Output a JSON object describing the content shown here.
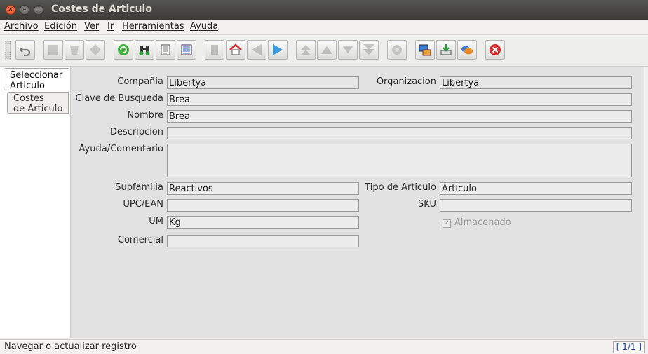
{
  "window": {
    "title": "Costes de Articulo"
  },
  "menu": [
    "Archivo",
    "Edición",
    "Ver",
    "Ir",
    "Herramientas",
    "Ayuda"
  ],
  "toolbar": [
    {
      "name": "undo-icon",
      "enabled": true
    },
    {
      "name": "new-record-icon",
      "enabled": false
    },
    {
      "name": "delete-record-icon",
      "enabled": false
    },
    {
      "name": "save-icon",
      "enabled": false
    },
    {
      "name": "refresh-icon",
      "enabled": true
    },
    {
      "name": "find-icon",
      "enabled": true
    },
    {
      "name": "history-icon",
      "enabled": true
    },
    {
      "name": "grid-toggle-icon",
      "enabled": true
    },
    {
      "name": "attachment-icon",
      "enabled": false
    },
    {
      "name": "parent-home-icon",
      "enabled": true
    },
    {
      "name": "detail-back-icon",
      "enabled": false
    },
    {
      "name": "detail-forward-icon",
      "enabled": true
    },
    {
      "name": "first-record-icon",
      "enabled": false
    },
    {
      "name": "previous-record-icon",
      "enabled": false
    },
    {
      "name": "next-record-icon",
      "enabled": false
    },
    {
      "name": "last-record-icon",
      "enabled": false
    },
    {
      "name": "report-icon",
      "enabled": false
    },
    {
      "name": "archive-icon",
      "enabled": true
    },
    {
      "name": "export-icon",
      "enabled": true
    },
    {
      "name": "chat-icon",
      "enabled": true
    },
    {
      "name": "exit-icon",
      "enabled": true
    }
  ],
  "tabs": [
    {
      "label_l1": "Seleccionar",
      "label_l2": "Articulo"
    },
    {
      "label_l1": "Costes",
      "label_l2": "de Articulo"
    }
  ],
  "form": {
    "compania": {
      "label": "Compañia",
      "value": "Libertya"
    },
    "organizacion": {
      "label": "Organizacion",
      "value": "Libertya"
    },
    "clave": {
      "label": "Clave de Busqueda",
      "value": "Brea"
    },
    "nombre": {
      "label": "Nombre",
      "value": "Brea"
    },
    "descripcion": {
      "label": "Descripcion",
      "value": ""
    },
    "ayuda": {
      "label": "Ayuda/Comentario",
      "value": ""
    },
    "subfamilia": {
      "label": "Subfamilia",
      "value": "Reactivos"
    },
    "tipo": {
      "label": "Tipo de Articulo",
      "value": "Artículo"
    },
    "upc": {
      "label": "UPC/EAN",
      "value": ""
    },
    "sku": {
      "label": "SKU",
      "value": ""
    },
    "um": {
      "label": "UM",
      "value": "Kg"
    },
    "almacenado": {
      "label": "Almacenado",
      "checked": true
    },
    "comercial": {
      "label": "Comercial",
      "value": ""
    }
  },
  "status": {
    "text": "Navegar o actualizar registro",
    "record": "[ 1/1 ]"
  },
  "colors": {
    "panel": "#e2e2e2",
    "field_border": "#9a9a9a",
    "record_text": "#1e3f9a",
    "exit_red": "#d92b2b"
  }
}
